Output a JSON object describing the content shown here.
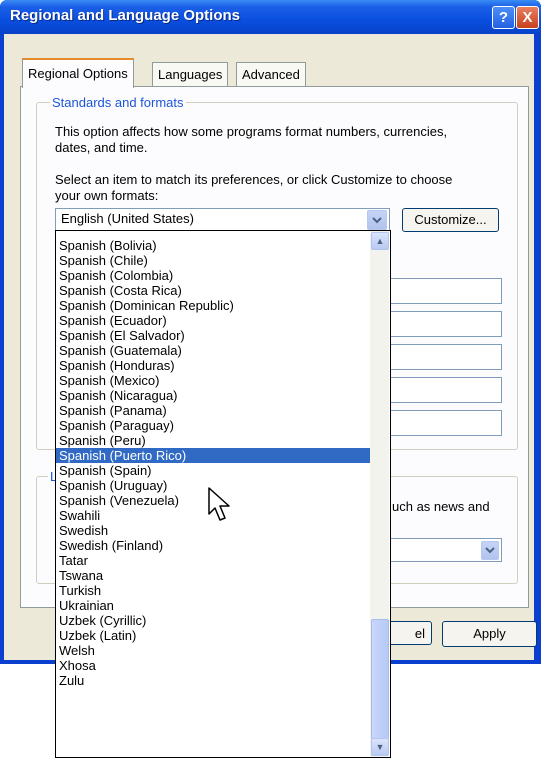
{
  "window": {
    "title": "Regional and Language Options",
    "help_glyph": "?",
    "close_glyph": "X"
  },
  "tabs": [
    "Regional Options",
    "Languages",
    "Advanced"
  ],
  "standards": {
    "group_label": "Standards and formats",
    "description": [
      "This option affects how some programs format numbers, currencies,",
      "dates, and time."
    ],
    "instruction": [
      "Select an item to match its preferences, or click Customize to choose",
      "your own formats:"
    ],
    "selected_locale": "English (United States)",
    "customize_label": "Customize..."
  },
  "location": {
    "group_label_fragment": "L",
    "text_fragment": "uch as news and"
  },
  "buttons": {
    "cancel_fragment": "el",
    "apply": "Apply"
  },
  "dropdown": {
    "selected_index": 16,
    "items": [
      "Spanish (Bolivia)",
      "Spanish (Chile)",
      "Spanish (Colombia)",
      "Spanish (Costa Rica)",
      "Spanish (Dominican Republic)",
      "Spanish (Ecuador)",
      "Spanish (El Salvador)",
      "Spanish (Guatemala)",
      "Spanish (Honduras)",
      "Spanish (Mexico)",
      "Spanish (Nicaragua)",
      "Spanish (Panama)",
      "Spanish (Paraguay)",
      "Spanish (Peru)",
      "Spanish (Puerto Rico)",
      "Spanish (Spain)",
      "Spanish (Uruguay)",
      "Spanish (Venezuela)",
      "Swahili",
      "Swedish",
      "Swedish (Finland)",
      "Tatar",
      "Tswana",
      "Turkish",
      "Ukrainian",
      "Uzbek (Cyrillic)",
      "Uzbek (Latin)",
      "Welsh",
      "Xhosa",
      "Zulu"
    ]
  },
  "colors": {
    "titlebar": "#0a4ee0",
    "selection": "#316ac5",
    "group_label": "#1c56d8"
  }
}
